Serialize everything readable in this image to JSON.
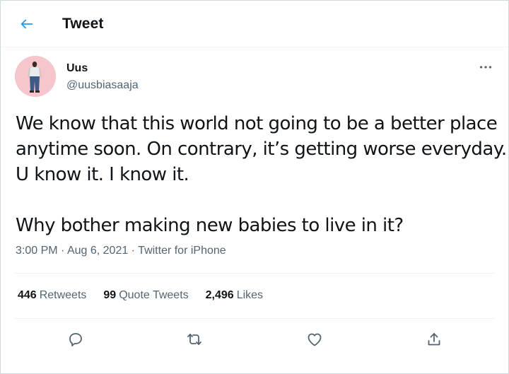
{
  "header": {
    "back_icon": "arrow-left-icon",
    "title": "Tweet"
  },
  "author": {
    "name": "Uus",
    "handle": "@uusbiasaaja",
    "avatar_icon": "profile-photo",
    "more_icon": "more-horizontal-icon"
  },
  "tweet": {
    "lines": [
      "We know that this world not going to be a better place",
      "anytime soon. On contrary, it’s getting worse everyday.",
      "U know it. I know it.",
      "",
      "Why bother making new babies to live in it?"
    ],
    "time": "3:00 PM",
    "separator": " · ",
    "date": "Aug 6, 2021",
    "source": "Twitter for iPhone"
  },
  "stats": {
    "retweets_count": "446",
    "retweets_label": "Retweets",
    "quotes_count": "99",
    "quotes_label": "Quote Tweets",
    "likes_count": "2,496",
    "likes_label": "Likes"
  },
  "actions": [
    "reply-icon",
    "retweet-icon",
    "like-icon",
    "share-icon"
  ],
  "colors": {
    "accent": "#1d9bf0",
    "text": "#0f1419",
    "secondary": "#536471",
    "divider": "#eff3f4",
    "avatar_bg": "#f7c6cd"
  }
}
